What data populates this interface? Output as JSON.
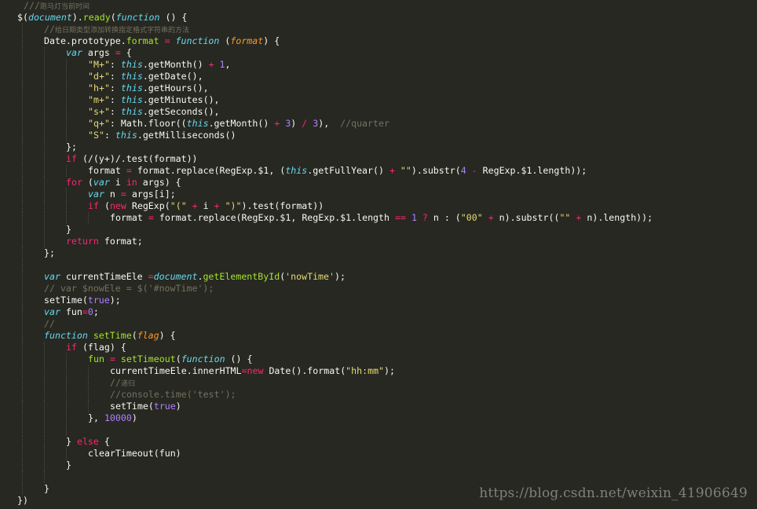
{
  "editor": {
    "theme_colors": {
      "background": "#272822",
      "keyword": "#f92672",
      "storage": "#66d9ef",
      "function": "#a6e22e",
      "string": "#e6db74",
      "number": "#ae81ff",
      "comment": "#75715e",
      "parameter": "#fd971f",
      "text": "#f8f8f2"
    },
    "lines": [
      {
        "indent": 1,
        "tokens": [
          [
            "cmt",
            "///"
          ],
          [
            "cjk",
            "跑马灯当前时间"
          ]
        ]
      },
      {
        "indent": 0,
        "tokens": [
          [
            "pl",
            "$("
          ],
          [
            "var",
            "document"
          ],
          [
            "pl",
            ")."
          ],
          [
            "fn",
            "ready"
          ],
          [
            "pl",
            "("
          ],
          [
            "kwi",
            "function"
          ],
          [
            "pl",
            " () {"
          ]
        ]
      },
      {
        "indent": 2,
        "tokens": [
          [
            "cmt",
            "//"
          ],
          [
            "cjk",
            "给日期类型添加转换指定格式字符串的方法"
          ]
        ]
      },
      {
        "indent": 2,
        "tokens": [
          [
            "pl",
            "Date.prototype."
          ],
          [
            "fn",
            "format"
          ],
          [
            "pl",
            " "
          ],
          [
            "op",
            "="
          ],
          [
            "pl",
            " "
          ],
          [
            "kwi",
            "function"
          ],
          [
            "pl",
            " ("
          ],
          [
            "par",
            "format"
          ],
          [
            "pl",
            ") {"
          ]
        ]
      },
      {
        "indent": 3,
        "tokens": [
          [
            "kwi",
            "var"
          ],
          [
            "pl",
            " args "
          ],
          [
            "op",
            "="
          ],
          [
            "pl",
            " {"
          ]
        ]
      },
      {
        "indent": 4,
        "tokens": [
          [
            "str",
            "\"M+\""
          ],
          [
            "pl",
            ": "
          ],
          [
            "this",
            "this"
          ],
          [
            "pl",
            ".getMonth() "
          ],
          [
            "op",
            "+"
          ],
          [
            "pl",
            " "
          ],
          [
            "num",
            "1"
          ],
          [
            "pl",
            ","
          ]
        ]
      },
      {
        "indent": 4,
        "tokens": [
          [
            "str",
            "\"d+\""
          ],
          [
            "pl",
            ": "
          ],
          [
            "this",
            "this"
          ],
          [
            "pl",
            ".getDate(),"
          ]
        ]
      },
      {
        "indent": 4,
        "tokens": [
          [
            "str",
            "\"h+\""
          ],
          [
            "pl",
            ": "
          ],
          [
            "this",
            "this"
          ],
          [
            "pl",
            ".getHours(),"
          ]
        ]
      },
      {
        "indent": 4,
        "tokens": [
          [
            "str",
            "\"m+\""
          ],
          [
            "pl",
            ": "
          ],
          [
            "this",
            "this"
          ],
          [
            "pl",
            ".getMinutes(),"
          ]
        ]
      },
      {
        "indent": 4,
        "tokens": [
          [
            "str",
            "\"s+\""
          ],
          [
            "pl",
            ": "
          ],
          [
            "this",
            "this"
          ],
          [
            "pl",
            ".getSeconds(),"
          ]
        ]
      },
      {
        "indent": 4,
        "tokens": [
          [
            "str",
            "\"q+\""
          ],
          [
            "pl",
            ": Math.floor(("
          ],
          [
            "this",
            "this"
          ],
          [
            "pl",
            ".getMonth() "
          ],
          [
            "op",
            "+"
          ],
          [
            "pl",
            " "
          ],
          [
            "num",
            "3"
          ],
          [
            "pl",
            ") "
          ],
          [
            "op",
            "/"
          ],
          [
            "pl",
            " "
          ],
          [
            "num",
            "3"
          ],
          [
            "pl",
            "),  "
          ],
          [
            "cmt",
            "//quarter"
          ]
        ]
      },
      {
        "indent": 4,
        "tokens": [
          [
            "str",
            "\"S\""
          ],
          [
            "pl",
            ": "
          ],
          [
            "this",
            "this"
          ],
          [
            "pl",
            ".getMilliseconds()"
          ]
        ]
      },
      {
        "indent": 3,
        "tokens": [
          [
            "pl",
            "};"
          ]
        ]
      },
      {
        "indent": 3,
        "tokens": [
          [
            "kw",
            "if"
          ],
          [
            "pl",
            " (/(y+)/.test(format))"
          ]
        ]
      },
      {
        "indent": 4,
        "tokens": [
          [
            "pl",
            "format "
          ],
          [
            "op",
            "="
          ],
          [
            "pl",
            " format.replace(RegExp.$1, ("
          ],
          [
            "this",
            "this"
          ],
          [
            "pl",
            ".getFullYear() "
          ],
          [
            "op",
            "+"
          ],
          [
            "pl",
            " "
          ],
          [
            "str",
            "\"\""
          ],
          [
            "pl",
            ").substr("
          ],
          [
            "num",
            "4"
          ],
          [
            "pl",
            " "
          ],
          [
            "op",
            "-"
          ],
          [
            "pl",
            " RegExp.$1.length));"
          ]
        ]
      },
      {
        "indent": 3,
        "tokens": [
          [
            "kw",
            "for"
          ],
          [
            "pl",
            " ("
          ],
          [
            "kwi",
            "var"
          ],
          [
            "pl",
            " i "
          ],
          [
            "kw",
            "in"
          ],
          [
            "pl",
            " args) {"
          ]
        ]
      },
      {
        "indent": 4,
        "tokens": [
          [
            "kwi",
            "var"
          ],
          [
            "pl",
            " n "
          ],
          [
            "op",
            "="
          ],
          [
            "pl",
            " args[i];"
          ]
        ]
      },
      {
        "indent": 4,
        "tokens": [
          [
            "kw",
            "if"
          ],
          [
            "pl",
            " ("
          ],
          [
            "kw",
            "new"
          ],
          [
            "pl",
            " RegExp("
          ],
          [
            "str",
            "\"(\""
          ],
          [
            "pl",
            " "
          ],
          [
            "op",
            "+"
          ],
          [
            "pl",
            " i "
          ],
          [
            "op",
            "+"
          ],
          [
            "pl",
            " "
          ],
          [
            "str",
            "\")\""
          ],
          [
            "pl",
            ").test(format))"
          ]
        ]
      },
      {
        "indent": 5,
        "tokens": [
          [
            "pl",
            "format "
          ],
          [
            "op",
            "="
          ],
          [
            "pl",
            " format.replace(RegExp.$1, RegExp.$1.length "
          ],
          [
            "op",
            "=="
          ],
          [
            "pl",
            " "
          ],
          [
            "num",
            "1"
          ],
          [
            "pl",
            " "
          ],
          [
            "op",
            "?"
          ],
          [
            "pl",
            " n : ("
          ],
          [
            "str",
            "\"00\""
          ],
          [
            "pl",
            " "
          ],
          [
            "op",
            "+"
          ],
          [
            "pl",
            " n).substr(("
          ],
          [
            "str",
            "\"\""
          ],
          [
            "pl",
            " "
          ],
          [
            "op",
            "+"
          ],
          [
            "pl",
            " n).length));"
          ]
        ]
      },
      {
        "indent": 3,
        "tokens": [
          [
            "pl",
            "}"
          ]
        ]
      },
      {
        "indent": 3,
        "tokens": [
          [
            "kw",
            "return"
          ],
          [
            "pl",
            " format;"
          ]
        ]
      },
      {
        "indent": 2,
        "tokens": [
          [
            "pl",
            "};"
          ]
        ]
      },
      {
        "indent": 2,
        "tokens": []
      },
      {
        "indent": 2,
        "tokens": [
          [
            "kwi",
            "var"
          ],
          [
            "pl",
            " currentTimeEle "
          ],
          [
            "op",
            "="
          ],
          [
            "var",
            "document"
          ],
          [
            "pl",
            "."
          ],
          [
            "fn",
            "getElementById"
          ],
          [
            "pl",
            "("
          ],
          [
            "str",
            "'nowTime'"
          ],
          [
            "pl",
            ");"
          ]
        ]
      },
      {
        "indent": 2,
        "tokens": [
          [
            "cmt",
            "// var $nowEle = $('#nowTime');"
          ]
        ]
      },
      {
        "indent": 2,
        "tokens": [
          [
            "pl",
            "setTime("
          ],
          [
            "num",
            "true"
          ],
          [
            "pl",
            ");"
          ]
        ]
      },
      {
        "indent": 2,
        "tokens": [
          [
            "kwi",
            "var"
          ],
          [
            "pl",
            " fun"
          ],
          [
            "op",
            "="
          ],
          [
            "num",
            "0"
          ],
          [
            "pl",
            ";"
          ]
        ]
      },
      {
        "indent": 2,
        "tokens": [
          [
            "cmt",
            "//"
          ]
        ]
      },
      {
        "indent": 2,
        "tokens": [
          [
            "kwi",
            "function"
          ],
          [
            "pl",
            " "
          ],
          [
            "fn",
            "setTime"
          ],
          [
            "pl",
            "("
          ],
          [
            "par",
            "flag"
          ],
          [
            "pl",
            ") {"
          ]
        ]
      },
      {
        "indent": 3,
        "tokens": [
          [
            "kw",
            "if"
          ],
          [
            "pl",
            " (flag) {"
          ]
        ]
      },
      {
        "indent": 4,
        "tokens": [
          [
            "fn",
            "fun"
          ],
          [
            "pl",
            " "
          ],
          [
            "op",
            "="
          ],
          [
            "pl",
            " "
          ],
          [
            "fn",
            "setTimeout"
          ],
          [
            "pl",
            "("
          ],
          [
            "kwi",
            "function"
          ],
          [
            "pl",
            " () {"
          ]
        ]
      },
      {
        "indent": 5,
        "tokens": [
          [
            "pl",
            "currentTimeEle.innerHTML"
          ],
          [
            "op",
            "="
          ],
          [
            "kw",
            "new"
          ],
          [
            "pl",
            " Date().format("
          ],
          [
            "str",
            "\"hh:mm\""
          ],
          [
            "pl",
            ");"
          ]
        ]
      },
      {
        "indent": 5,
        "tokens": [
          [
            "cmt",
            "//"
          ],
          [
            "cjk",
            "递归"
          ]
        ]
      },
      {
        "indent": 5,
        "tokens": [
          [
            "cmt",
            "//console.time('test');"
          ]
        ]
      },
      {
        "indent": 5,
        "tokens": [
          [
            "pl",
            "setTime("
          ],
          [
            "num",
            "true"
          ],
          [
            "pl",
            ")"
          ]
        ]
      },
      {
        "indent": 4,
        "tokens": [
          [
            "pl",
            "}, "
          ],
          [
            "num",
            "10000"
          ],
          [
            "pl",
            ")"
          ]
        ]
      },
      {
        "indent": 4,
        "tokens": []
      },
      {
        "indent": 3,
        "tokens": [
          [
            "pl",
            "} "
          ],
          [
            "kw",
            "else"
          ],
          [
            "pl",
            " {"
          ]
        ]
      },
      {
        "indent": 4,
        "tokens": [
          [
            "pl",
            "clearTimeout(fun)"
          ]
        ]
      },
      {
        "indent": 3,
        "tokens": [
          [
            "pl",
            "}"
          ]
        ]
      },
      {
        "indent": 3,
        "tokens": []
      },
      {
        "indent": 2,
        "tokens": [
          [
            "pl",
            "}"
          ]
        ]
      },
      {
        "indent": 1,
        "tokens": [
          [
            "pl",
            "})"
          ]
        ]
      }
    ]
  },
  "watermark": {
    "text": "https://blog.csdn.net/weixin_41906649"
  }
}
